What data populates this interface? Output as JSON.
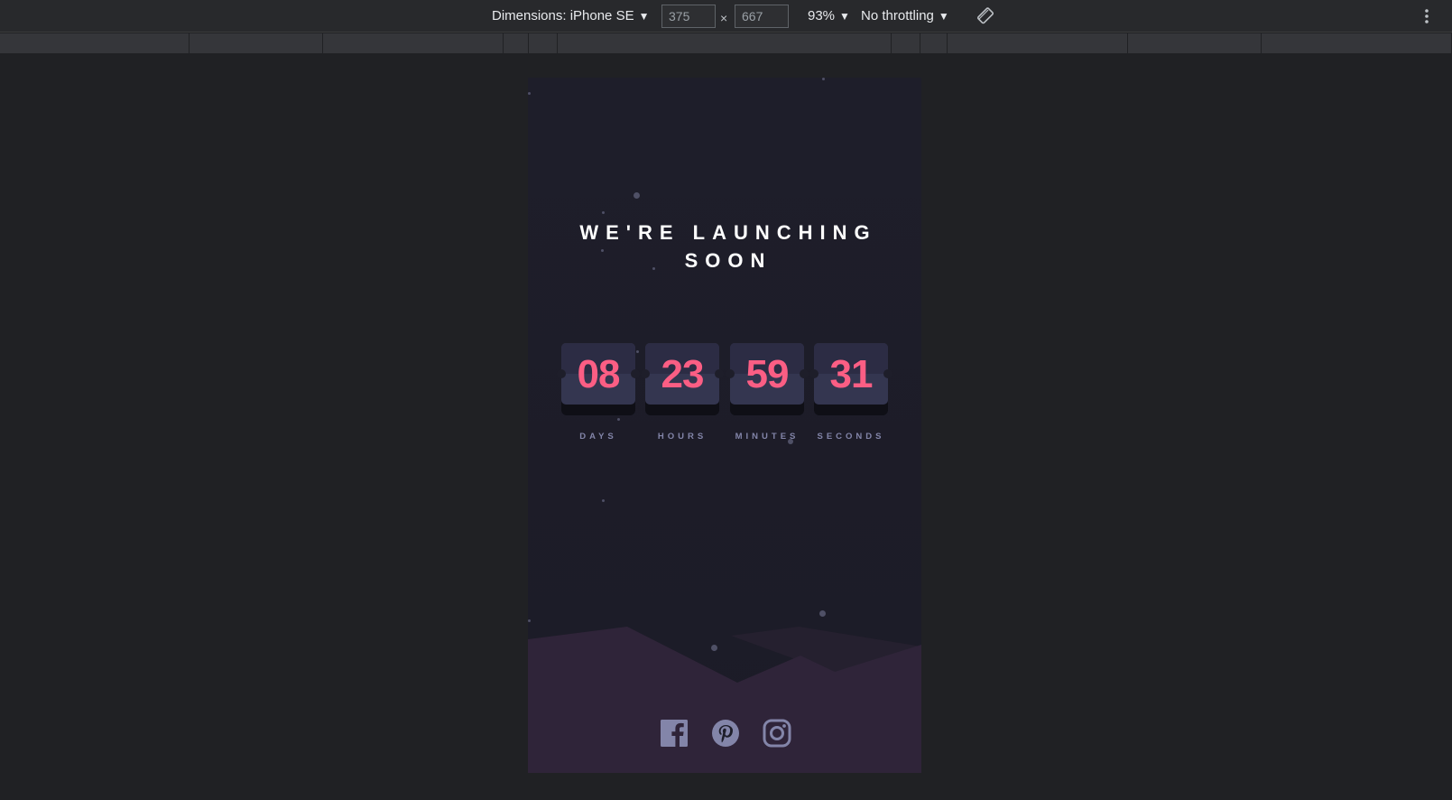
{
  "toolbar": {
    "dimensions_label": "Dimensions: iPhone SE",
    "width_value": "375",
    "times": "×",
    "height_value": "667",
    "zoom": "93%",
    "throttling": "No throttling",
    "icons": [
      "rotate-icon",
      "more-options-icon"
    ]
  },
  "page": {
    "heading": "WE'RE LAUNCHING SOON",
    "countdown": [
      {
        "value": "08",
        "label": "DAYS"
      },
      {
        "value": "23",
        "label": "HOURS"
      },
      {
        "value": "59",
        "label": "MINUTES"
      },
      {
        "value": "31",
        "label": "SECONDS"
      }
    ],
    "social": [
      "facebook-icon",
      "pinterest-icon",
      "instagram-icon"
    ],
    "colors": {
      "background": "#1e1e2a",
      "card": "#343650",
      "number": "#fb5e84",
      "label": "#8385a9",
      "hills": "#2f2439",
      "icon": "#8385a9"
    }
  }
}
